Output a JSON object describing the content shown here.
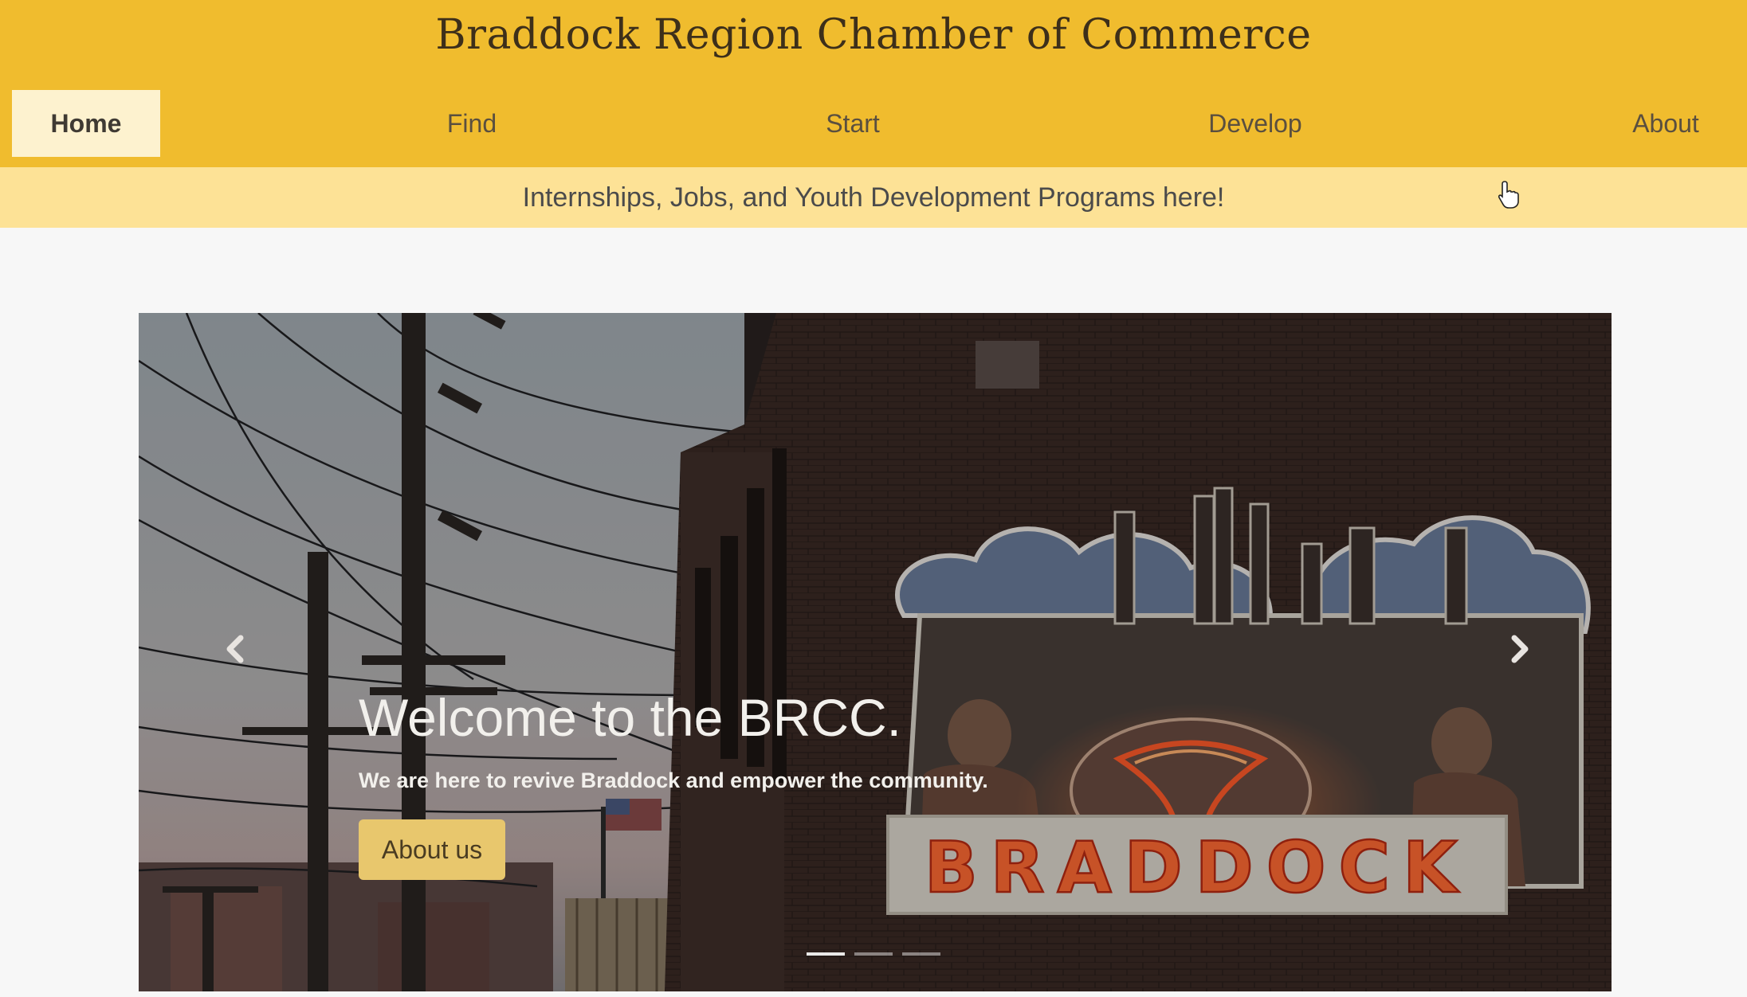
{
  "header": {
    "title": "Braddock Region Chamber of Commerce"
  },
  "nav": {
    "items": [
      {
        "label": "Home",
        "active": true
      },
      {
        "label": "Find",
        "active": false
      },
      {
        "label": "Start",
        "active": false
      },
      {
        "label": "Develop",
        "active": false
      },
      {
        "label": "About",
        "active": false
      }
    ]
  },
  "announcement": {
    "text": "Internships, Jobs, and Youth Development Programs here!"
  },
  "carousel": {
    "slide_count": 3,
    "active_index": 0,
    "caption_title": "Welcome to the BRCC.",
    "caption_subtitle": "We are here to revive Braddock and empower the community.",
    "button_label": "About us",
    "mural_sign_text": "BRADDOCK",
    "prev_icon": "chevron-left-icon",
    "next_icon": "chevron-right-icon"
  },
  "colors": {
    "header_bg": "#f0bc2e",
    "announcement_bg": "#fde296",
    "active_nav_bg": "#fdf2cf",
    "button_bg": "#e8c76d",
    "neon": "#ff5a2a"
  }
}
